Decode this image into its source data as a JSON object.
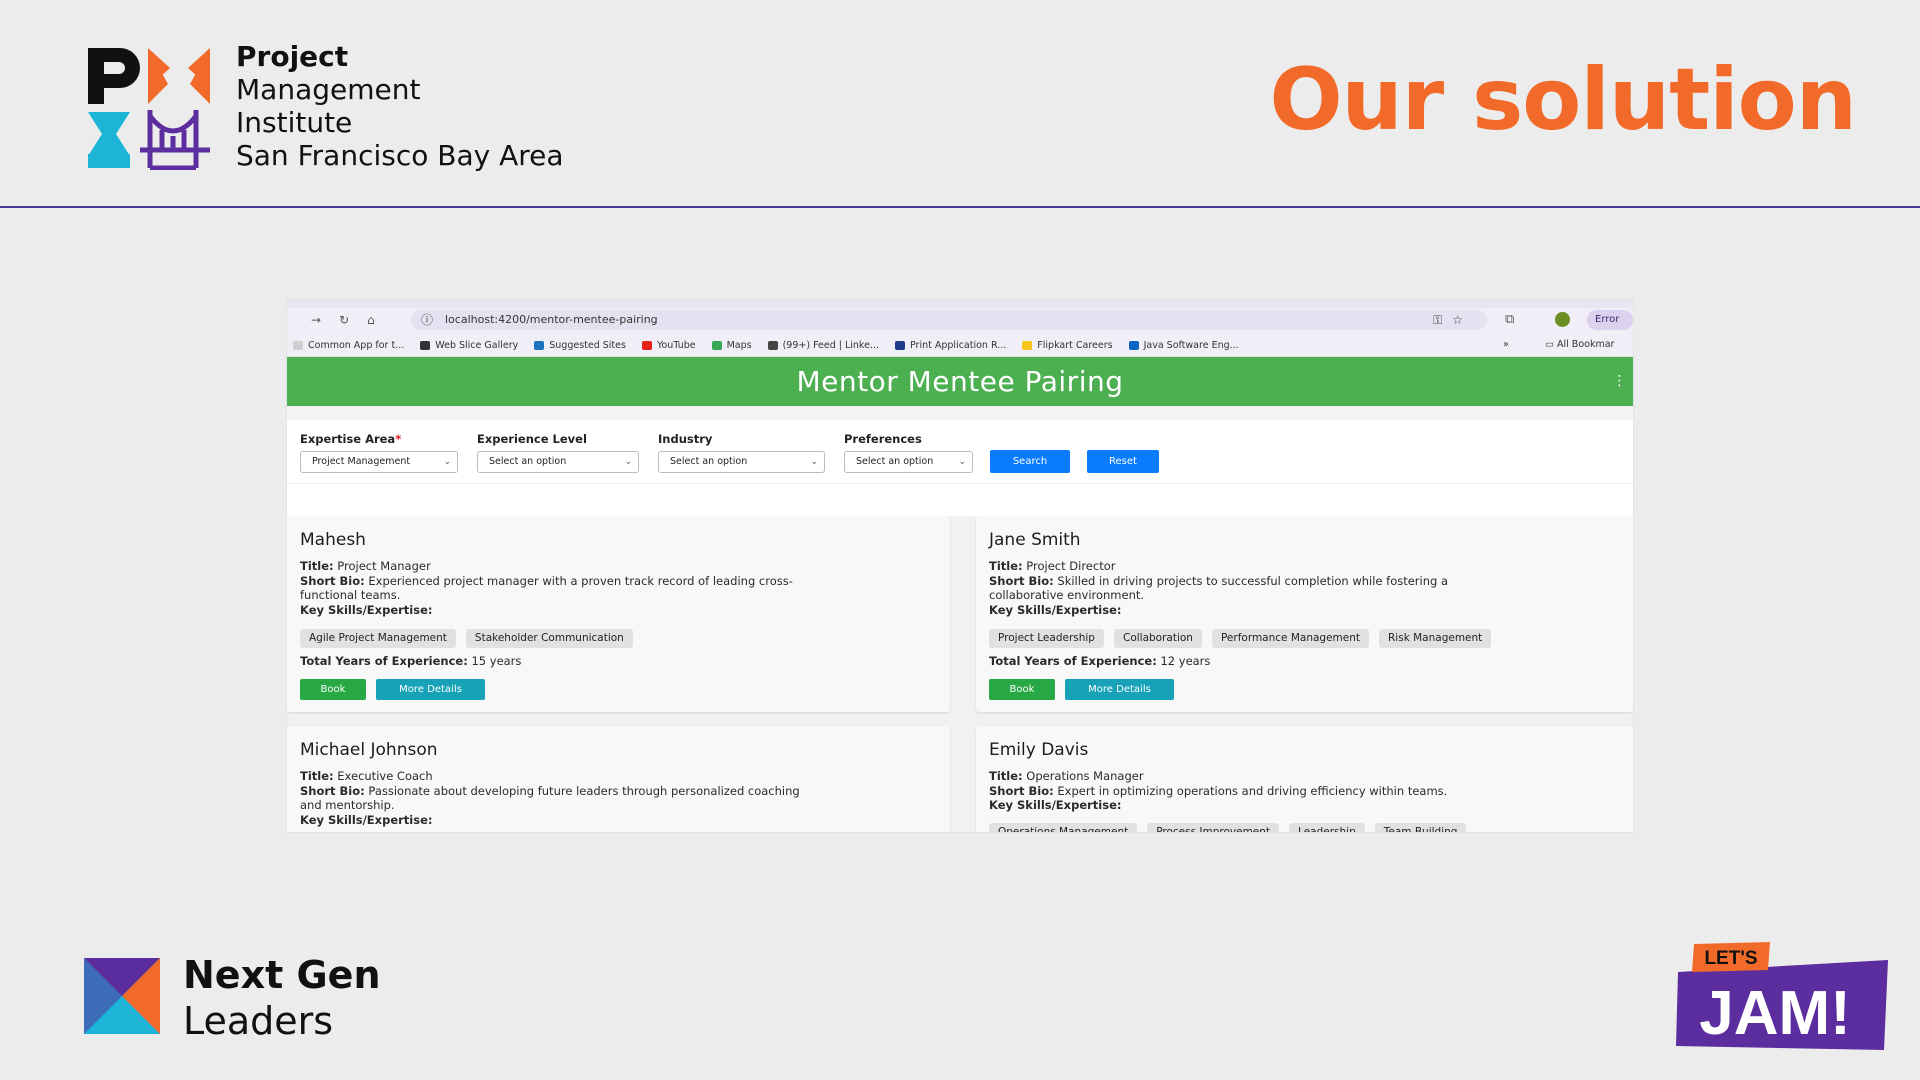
{
  "slide": {
    "org_lines": [
      "Project",
      "Management",
      "Institute",
      "San Francisco Bay Area"
    ],
    "title": "Our solution",
    "footer_lines": [
      "Next Gen",
      "Leaders"
    ],
    "badge_top": "LET'S",
    "badge_main": "JAM!",
    "colors": {
      "accent": "#f26a2a",
      "divider": "#4b3a8f",
      "purple": "#5b2d9e",
      "teal": "#1cb5d8"
    }
  },
  "browser": {
    "url": "localhost:4200/mentor-mentee-pairing",
    "profile_status": "Error",
    "bookmarks": [
      {
        "label": "Common App for t...",
        "color": "#cfcfcf"
      },
      {
        "label": "Web Slice Gallery",
        "color": "#333333"
      },
      {
        "label": "Suggested Sites",
        "color": "#1e73be"
      },
      {
        "label": "YouTube",
        "color": "#e62117"
      },
      {
        "label": "Maps",
        "color": "#34a853"
      },
      {
        "label": "(99+) Feed | Linke...",
        "color": "#444444"
      },
      {
        "label": "Print Application R...",
        "color": "#1e3a8a"
      },
      {
        "label": "Flipkart Careers",
        "color": "#f5c518"
      },
      {
        "label": "Java Software Eng...",
        "color": "#0a66c2"
      }
    ],
    "bookmarks_overflow": "»",
    "all_bookmarks": "All Bookmar"
  },
  "app": {
    "title": "Mentor Mentee Pairing",
    "filters": [
      {
        "label": "Expertise Area",
        "required": "*",
        "value": "Project Management"
      },
      {
        "label": "Experience Level",
        "required": "",
        "value": "Select an option"
      },
      {
        "label": "Industry",
        "required": "",
        "value": "Select an option"
      },
      {
        "label": "Preferences",
        "required": "",
        "value": "Select an option"
      }
    ],
    "search_label": "Search",
    "reset_label": "Reset",
    "field_labels": {
      "title": "Title:",
      "bio": "Short Bio:",
      "skills": "Key Skills/Expertise:",
      "experience": "Total Years of Experience:"
    },
    "book_label": "Book",
    "details_label": "More Details",
    "mentors": [
      {
        "name": "Mahesh",
        "title": "Project Manager",
        "bio_1": "Experienced project manager with a proven track record of leading cross-",
        "bio_2": "functional teams.",
        "skills": [
          "Agile Project Management",
          "Stakeholder Communication"
        ],
        "experience": "15 years"
      },
      {
        "name": "Jane Smith",
        "title": "Project Director",
        "bio_1": "Skilled in driving projects to successful completion while fostering a",
        "bio_2": "collaborative environment.",
        "skills": [
          "Project Leadership",
          "Collaboration",
          "Performance Management",
          "Risk Management"
        ],
        "experience": "12 years"
      },
      {
        "name": "Michael Johnson",
        "title": "Executive Coach",
        "bio_1": "Passionate about developing future leaders through personalized coaching",
        "bio_2": "and mentorship.",
        "skills": [],
        "experience": ""
      },
      {
        "name": "Emily Davis",
        "title": "Operations Manager",
        "bio_1": "Expert in optimizing operations and driving efficiency within teams.",
        "bio_2": "",
        "skills": [
          "Operations Management",
          "Process Improvement",
          "Leadership",
          "Team Building"
        ],
        "experience": ""
      }
    ]
  }
}
